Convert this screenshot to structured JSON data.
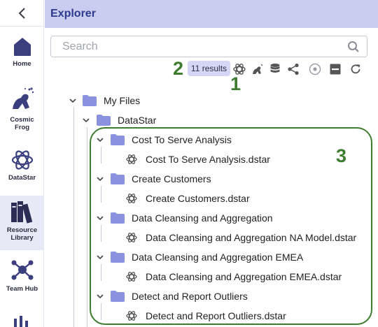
{
  "rail": {
    "items": [
      {
        "label": "Home",
        "icon": "home-icon"
      },
      {
        "label": "Cosmic Frog",
        "icon": "cosmic-frog-icon"
      },
      {
        "label": "DataStar",
        "icon": "datastar-icon"
      },
      {
        "label": "Resource Library",
        "icon": "resource-library-icon"
      },
      {
        "label": "Team Hub",
        "icon": "team-hub-icon"
      }
    ]
  },
  "explorer": {
    "title": "Explorer",
    "search_placeholder": "Search",
    "results_label": "11 results"
  },
  "annotations": {
    "one": "1",
    "two": "2",
    "three": "3"
  },
  "tree": {
    "root": "My Files",
    "datastar": "DataStar",
    "folders": [
      {
        "name": "Cost To Serve Analysis",
        "file": "Cost To Serve Analysis.dstar"
      },
      {
        "name": "Create Customers",
        "file": "Create Customers.dstar"
      },
      {
        "name": "Data Cleansing and Aggregation",
        "file": "Data Cleansing and Aggregation NA Model.dstar"
      },
      {
        "name": "Data Cleansing and Aggregation EMEA",
        "file": "Data Cleansing and Aggregation EMEA.dstar"
      },
      {
        "name": "Detect and Report Outliers",
        "file": "Detect and Report Outliers.dstar"
      }
    ]
  },
  "colors": {
    "accent": "#2e3a8c",
    "header_bg": "#c9cdf0",
    "folder": "#8a92e0",
    "annotation": "#3e7c2f"
  }
}
